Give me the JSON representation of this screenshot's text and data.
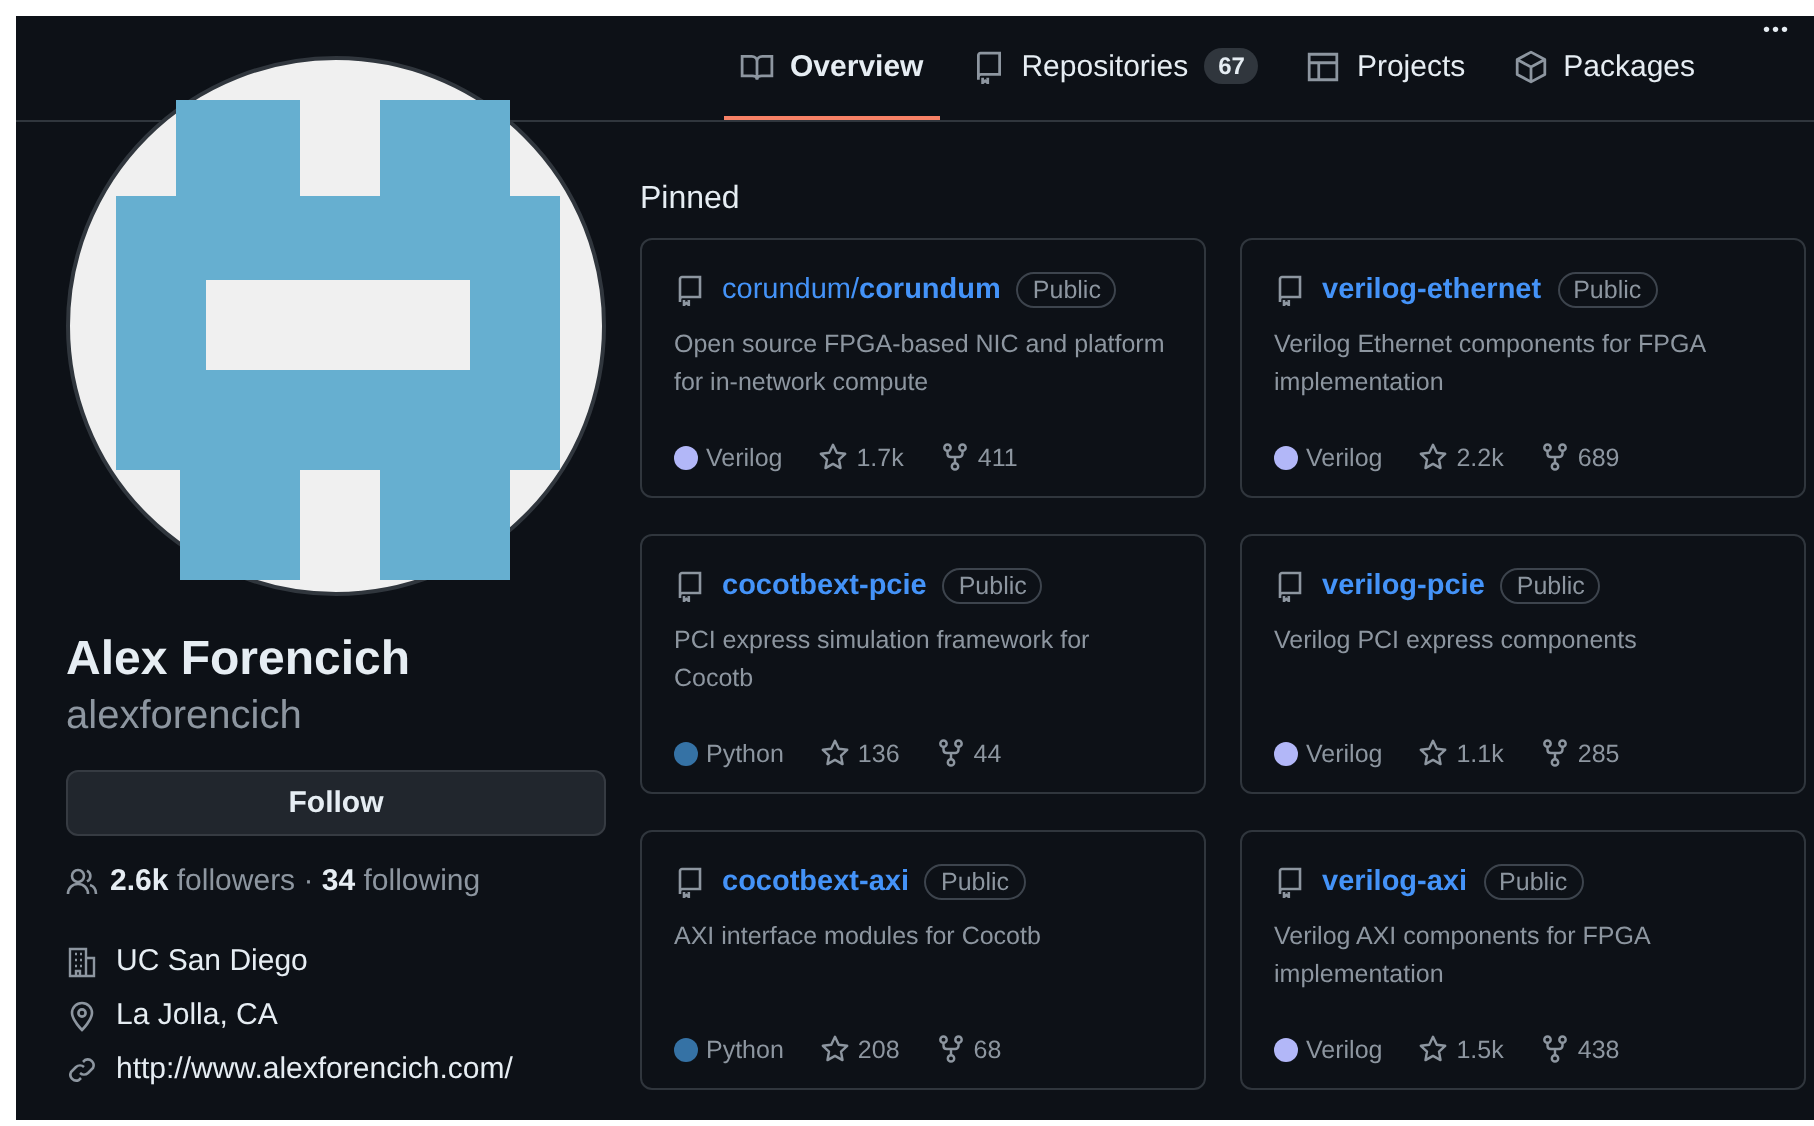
{
  "tabs": [
    {
      "label": "Overview",
      "kind": "book",
      "selected": true
    },
    {
      "label": "Repositories",
      "kind": "repo",
      "count": "67",
      "selected": false
    },
    {
      "label": "Projects",
      "kind": "table",
      "selected": false
    },
    {
      "label": "Packages",
      "kind": "package",
      "selected": false
    }
  ],
  "more_button": "•••",
  "profile": {
    "name": "Alex Forencich",
    "username": "alexforencich",
    "follow_button": "Follow",
    "followers": "**2.6k** followers · **34** following",
    "details": [
      {
        "kind": "organization",
        "text": "UC San Diego"
      },
      {
        "kind": "location",
        "text": "La Jolla, CA"
      },
      {
        "kind": "link",
        "text": "http://www.alexforencich.com/"
      }
    ]
  },
  "pinned": {
    "title": "Pinned",
    "repos": [
      {
        "name": "corundum/**corundum**",
        "visibility": "Public",
        "description": "Open source FPGA-based NIC and platform for in-network compute",
        "language": "Verilog",
        "color": "#b2b7f8",
        "stars": "1.7k",
        "forks": "411"
      },
      {
        "name": "verilog-ethernet",
        "visibility": "Public",
        "description": "Verilog Ethernet components for FPGA implementation",
        "language": "Verilog",
        "color": "#b2b7f8",
        "stars": "2.2k",
        "forks": "689"
      },
      {
        "name": "cocotbext-pcie",
        "visibility": "Public",
        "description": "PCI express simulation framework for Cocotb",
        "language": "Python",
        "color": "#3572a5",
        "stars": "136",
        "forks": "44"
      },
      {
        "name": "verilog-pcie",
        "visibility": "Public",
        "description": "Verilog PCI express components",
        "language": "Verilog",
        "color": "#b2b7f8",
        "stars": "1.1k",
        "forks": "285"
      },
      {
        "name": "cocotbext-axi",
        "visibility": "Public",
        "description": "AXI interface modules for Cocotb",
        "language": "Python",
        "color": "#3572a5",
        "stars": "208",
        "forks": "68"
      },
      {
        "name": "verilog-axi",
        "visibility": "Public",
        "description": "Verilog AXI components for FPGA implementation",
        "language": "Verilog",
        "color": "#b2b7f8",
        "stars": "1.5k",
        "forks": "438"
      }
    ]
  }
}
